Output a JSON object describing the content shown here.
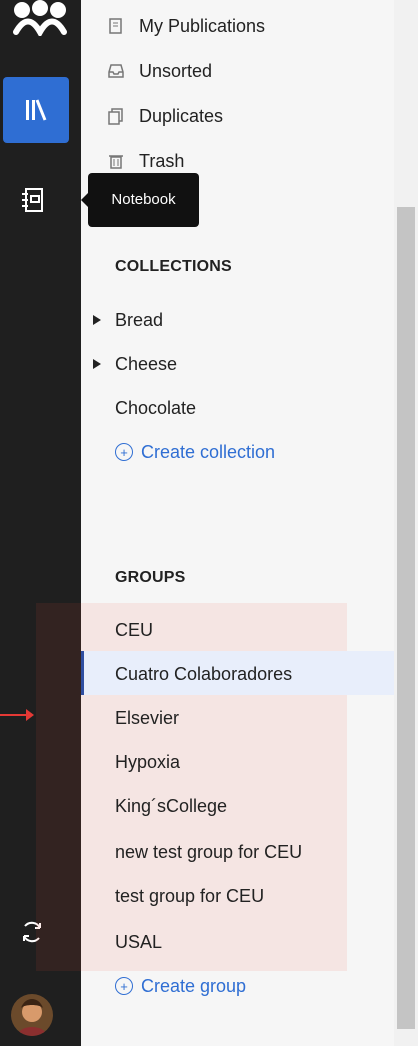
{
  "rail": {
    "tooltip": "Notebook",
    "icons": [
      "logo-icon",
      "library-icon",
      "notebook-icon",
      "sync-icon",
      "avatar"
    ]
  },
  "library": [
    {
      "icon": "doc-icon",
      "label": "My Publications"
    },
    {
      "icon": "inbox-icon",
      "label": "Unsorted"
    },
    {
      "icon": "copy-icon",
      "label": "Duplicates"
    },
    {
      "icon": "trash-icon",
      "label": "Trash"
    }
  ],
  "collections": {
    "header": "COLLECTIONS",
    "items": [
      {
        "label": "Bread"
      },
      {
        "label": "Cheese"
      },
      {
        "label": "Chocolate"
      }
    ],
    "create": "Create collection"
  },
  "groups": {
    "header": "GROUPS",
    "items": [
      {
        "label": "CEU"
      },
      {
        "label": "Cuatro Colaboradores"
      },
      {
        "label": "Elsevier"
      },
      {
        "label": "Hypoxia"
      },
      {
        "label": "King´sCollege"
      },
      {
        "label": "new test group for CEU"
      },
      {
        "label": "test group for CEU"
      },
      {
        "label": "USAL"
      }
    ],
    "create": "Create group"
  },
  "colors": {
    "rail_bg": "#1f1f1f",
    "accent": "#2f6ed3",
    "selected_row": "#e8eefb",
    "groups_highlight": "rgba(231,76,60,0.10)"
  }
}
